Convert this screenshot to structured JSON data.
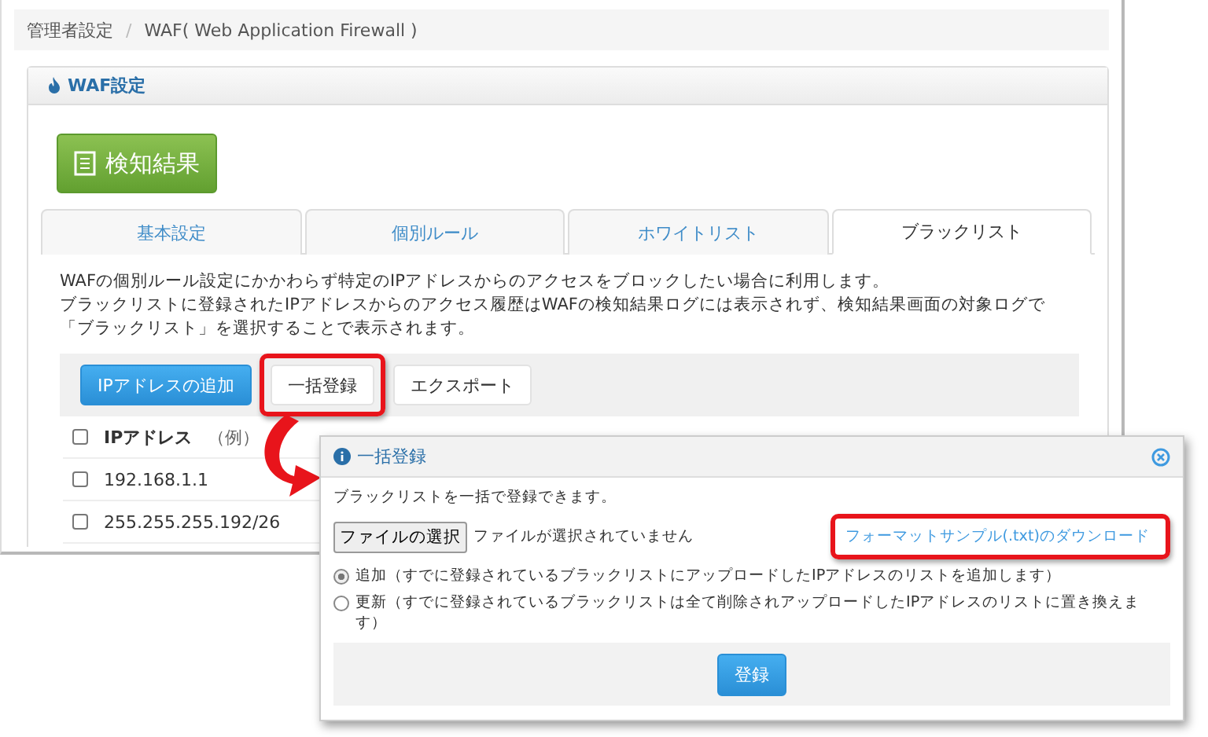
{
  "breadcrumb": [
    "管理者設定",
    "WAF( Web Application Firewall )"
  ],
  "breadcrumb_separator": "/",
  "panel": {
    "title": "WAF設定"
  },
  "detection_button": "検知結果",
  "tabs": [
    {
      "label": "基本設定",
      "selected": false
    },
    {
      "label": "個別ルール",
      "selected": false
    },
    {
      "label": "ホワイトリスト",
      "selected": false
    },
    {
      "label": "ブラックリスト",
      "selected": true
    }
  ],
  "description": [
    "WAFの個別ルール設定にかかわらず特定のIPアドレスからのアクセスをブロックしたい場合に利用します。",
    "ブラックリストに登録されたIPアドレスからのアクセス履歴はWAFの検知結果ログには表示されず、検知結果画面の対象ログで「ブラックリスト」を選択することで表示されます。"
  ],
  "toolbar": [
    {
      "label": "IPアドレスの追加",
      "kind": "primary",
      "highlighted": false
    },
    {
      "label": "一括登録",
      "kind": "default",
      "highlighted": true
    },
    {
      "label": "エクスポート",
      "kind": "default",
      "highlighted": false
    }
  ],
  "table": {
    "header": {
      "checked": false,
      "column": "IPアドレス",
      "example": "（例）"
    },
    "rows": [
      {
        "checked": false,
        "ip": "192.168.1.1"
      },
      {
        "checked": false,
        "ip": "255.255.255.192/26"
      }
    ]
  },
  "dialog": {
    "title": "一括登録",
    "message": "ブラックリストを一括で登録できます。",
    "file_button": "ファイルの選択",
    "file_status": "ファイルが選択されていません",
    "download_link": "フォーマットサンプル(.txt)のダウンロード",
    "link_highlighted": true,
    "options": [
      {
        "label": "追加（すでに登録されているブラックリストにアップロードしたIPアドレスのリストを追加します）",
        "selected": true
      },
      {
        "label": "更新（すでに登録されているブラックリストは全て削除されアップロードしたIPアドレスのリストに置き換えます）",
        "selected": false
      }
    ],
    "submit": "登録"
  }
}
